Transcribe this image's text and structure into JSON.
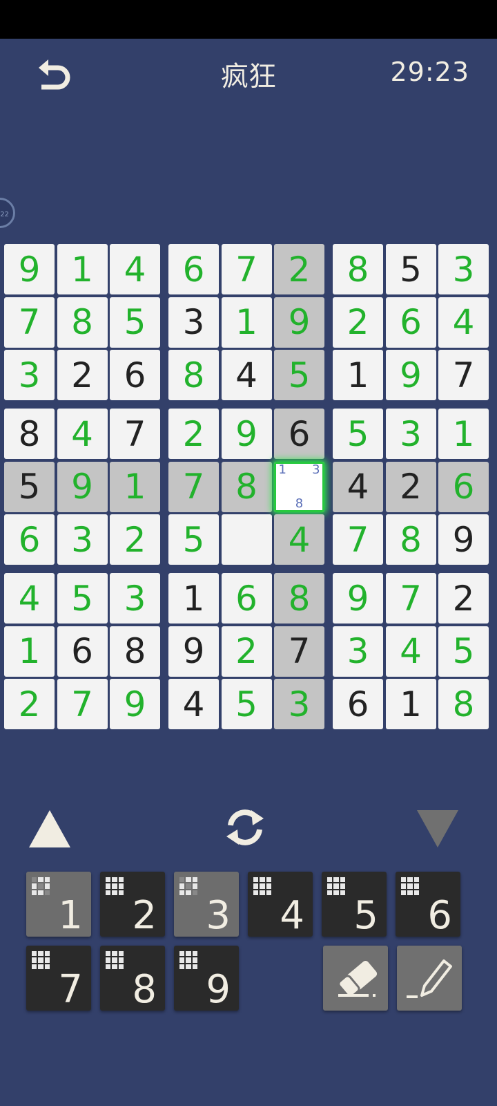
{
  "header": {
    "title": "疯狂",
    "timer": "29:23"
  },
  "side_badge": "22",
  "colors": {
    "given": "#222222",
    "user": "#22b22c",
    "selected_glow": "#2ee84a",
    "highlight": "#c4c4c4",
    "background": "#33406a"
  },
  "board": {
    "rows": [
      [
        {
          "v": "9",
          "t": "user"
        },
        {
          "v": "1",
          "t": "user"
        },
        {
          "v": "4",
          "t": "user"
        },
        {
          "v": "6",
          "t": "user"
        },
        {
          "v": "7",
          "t": "user"
        },
        {
          "v": "2",
          "t": "user"
        },
        {
          "v": "8",
          "t": "user"
        },
        {
          "v": "5",
          "t": "given"
        },
        {
          "v": "3",
          "t": "user"
        }
      ],
      [
        {
          "v": "7",
          "t": "user"
        },
        {
          "v": "8",
          "t": "user"
        },
        {
          "v": "5",
          "t": "user"
        },
        {
          "v": "3",
          "t": "given"
        },
        {
          "v": "1",
          "t": "user"
        },
        {
          "v": "9",
          "t": "user"
        },
        {
          "v": "2",
          "t": "user"
        },
        {
          "v": "6",
          "t": "user"
        },
        {
          "v": "4",
          "t": "user"
        }
      ],
      [
        {
          "v": "3",
          "t": "user"
        },
        {
          "v": "2",
          "t": "given"
        },
        {
          "v": "6",
          "t": "given"
        },
        {
          "v": "8",
          "t": "user"
        },
        {
          "v": "4",
          "t": "given"
        },
        {
          "v": "5",
          "t": "user"
        },
        {
          "v": "1",
          "t": "given"
        },
        {
          "v": "9",
          "t": "user"
        },
        {
          "v": "7",
          "t": "given"
        }
      ],
      [
        {
          "v": "8",
          "t": "given"
        },
        {
          "v": "4",
          "t": "user"
        },
        {
          "v": "7",
          "t": "given"
        },
        {
          "v": "2",
          "t": "user"
        },
        {
          "v": "9",
          "t": "user"
        },
        {
          "v": "6",
          "t": "given"
        },
        {
          "v": "5",
          "t": "user"
        },
        {
          "v": "3",
          "t": "user"
        },
        {
          "v": "1",
          "t": "user"
        }
      ],
      [
        {
          "v": "5",
          "t": "given"
        },
        {
          "v": "9",
          "t": "user"
        },
        {
          "v": "1",
          "t": "user"
        },
        {
          "v": "7",
          "t": "user"
        },
        {
          "v": "8",
          "t": "user"
        },
        {
          "v": "",
          "t": "notes",
          "notes": [
            "1",
            "",
            "3",
            "",
            "",
            "",
            "",
            "8",
            ""
          ]
        },
        {
          "v": "4",
          "t": "given"
        },
        {
          "v": "2",
          "t": "given"
        },
        {
          "v": "6",
          "t": "user"
        }
      ],
      [
        {
          "v": "6",
          "t": "user"
        },
        {
          "v": "3",
          "t": "user"
        },
        {
          "v": "2",
          "t": "user"
        },
        {
          "v": "5",
          "t": "user"
        },
        {
          "v": "",
          "t": "empty"
        },
        {
          "v": "4",
          "t": "user"
        },
        {
          "v": "7",
          "t": "user"
        },
        {
          "v": "8",
          "t": "user"
        },
        {
          "v": "9",
          "t": "given"
        }
      ],
      [
        {
          "v": "4",
          "t": "user"
        },
        {
          "v": "5",
          "t": "user"
        },
        {
          "v": "3",
          "t": "user"
        },
        {
          "v": "1",
          "t": "given"
        },
        {
          "v": "6",
          "t": "user"
        },
        {
          "v": "8",
          "t": "user"
        },
        {
          "v": "9",
          "t": "user"
        },
        {
          "v": "7",
          "t": "user"
        },
        {
          "v": "2",
          "t": "given"
        }
      ],
      [
        {
          "v": "1",
          "t": "user"
        },
        {
          "v": "6",
          "t": "given"
        },
        {
          "v": "8",
          "t": "given"
        },
        {
          "v": "9",
          "t": "given"
        },
        {
          "v": "2",
          "t": "user"
        },
        {
          "v": "7",
          "t": "given"
        },
        {
          "v": "3",
          "t": "user"
        },
        {
          "v": "4",
          "t": "user"
        },
        {
          "v": "5",
          "t": "user"
        }
      ],
      [
        {
          "v": "2",
          "t": "user"
        },
        {
          "v": "7",
          "t": "user"
        },
        {
          "v": "9",
          "t": "user"
        },
        {
          "v": "4",
          "t": "given"
        },
        {
          "v": "5",
          "t": "user"
        },
        {
          "v": "3",
          "t": "user"
        },
        {
          "v": "6",
          "t": "given"
        },
        {
          "v": "1",
          "t": "given"
        },
        {
          "v": "8",
          "t": "user"
        }
      ]
    ],
    "selected": {
      "row": 4,
      "col": 5
    }
  },
  "controls": {
    "up_icon": "triangle-up-icon",
    "refresh_icon": "refresh-icon",
    "down_icon": "triangle-down-icon"
  },
  "numpad": [
    {
      "digit": "1",
      "done": true
    },
    {
      "digit": "2",
      "done": false
    },
    {
      "digit": "3",
      "done": true
    },
    {
      "digit": "4",
      "done": false
    },
    {
      "digit": "5",
      "done": false
    },
    {
      "digit": "6",
      "done": false
    },
    {
      "digit": "7",
      "done": false
    },
    {
      "digit": "8",
      "done": false
    },
    {
      "digit": "9",
      "done": false
    }
  ],
  "tools": {
    "eraser_icon": "eraser-icon",
    "pencil_icon": "pencil-icon"
  }
}
